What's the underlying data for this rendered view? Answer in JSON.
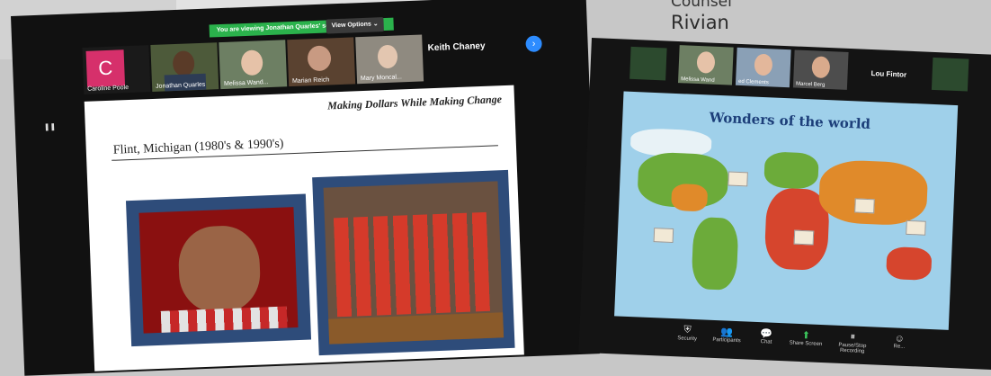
{
  "caption": {
    "line1": "Counsel",
    "line2": "Rivian"
  },
  "left_screen": {
    "banner": "You are viewing Jonathan Quarles' screen",
    "view_options": "View Options ⌄",
    "participants": [
      {
        "name": "Caroline Poole",
        "initial": "C"
      },
      {
        "name": "Jonathan Quarles"
      },
      {
        "name": "Melissa Wand..."
      },
      {
        "name": "Marian Reich"
      },
      {
        "name": "Mary Moncal..."
      }
    ],
    "speaker": "Keith Chaney",
    "slide": {
      "title": "Making Dollars While Making Change",
      "subtitle": "Flint, Michigan (1980's & 1990's)"
    }
  },
  "right_screen": {
    "participants": [
      {
        "name": "Melissa Wand"
      },
      {
        "name": "ed Clements"
      },
      {
        "name": "Marcel Berg"
      }
    ],
    "speaker": "Lou Fintor",
    "map_title": "Wonders of the world",
    "toolbar": [
      {
        "label": "Security",
        "icon": "shield-icon",
        "glyph": "⛨"
      },
      {
        "label": "Participants",
        "icon": "participants-icon",
        "glyph": "👥"
      },
      {
        "label": "Chat",
        "icon": "chat-icon",
        "glyph": "💬"
      },
      {
        "label": "Share Screen",
        "icon": "share-screen-icon",
        "glyph": "⬆"
      },
      {
        "label": "Pause/Stop Recording",
        "icon": "record-icon",
        "glyph": "⏸"
      },
      {
        "label": "Re...",
        "icon": "reactions-icon",
        "glyph": "☺"
      }
    ]
  }
}
